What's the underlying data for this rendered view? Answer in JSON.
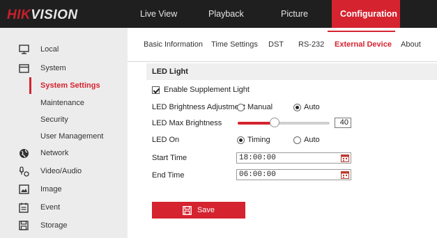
{
  "brand": {
    "logo_red": "HIK",
    "logo_white": "VISION",
    "accent": "#d5232f"
  },
  "topnav": [
    "Live View",
    "Playback",
    "Picture",
    "Configuration"
  ],
  "sidebar": [
    {
      "label": "Local",
      "icon": "monitor-icon"
    },
    {
      "label": "System",
      "icon": "system-icon"
    },
    {
      "label": "System Settings",
      "icon": ""
    },
    {
      "label": "Maintenance",
      "icon": ""
    },
    {
      "label": "Security",
      "icon": ""
    },
    {
      "label": "User Management",
      "icon": ""
    },
    {
      "label": "Network",
      "icon": "globe-icon"
    },
    {
      "label": "Video/Audio",
      "icon": "microphone-camera-icon"
    },
    {
      "label": "Image",
      "icon": "image-icon"
    },
    {
      "label": "Event",
      "icon": "calendar-list-icon"
    },
    {
      "label": "Storage",
      "icon": "save-disk-icon"
    }
  ],
  "subtabs": [
    "Basic Information",
    "Time Settings",
    "DST",
    "RS-232",
    "External Device",
    "About"
  ],
  "form": {
    "section_title": "LED Light",
    "enable_label": "Enable Supplement Light",
    "enable_checked": true,
    "brightness_adjust_label": "LED Brightness Adjustment",
    "brightness_adjust_options": [
      "Manual",
      "Auto"
    ],
    "brightness_adjust_selected": "Auto",
    "max_brightness_label": "LED Max Brightness",
    "max_brightness_value": "40",
    "led_on_label": "LED On",
    "led_on_options": [
      "Timing",
      "Auto"
    ],
    "led_on_selected": "Timing",
    "start_time_label": "Start Time",
    "start_time_value": "18:00:00",
    "end_time_label": "End Time",
    "end_time_value": "06:00:00",
    "save_label": "Save"
  }
}
